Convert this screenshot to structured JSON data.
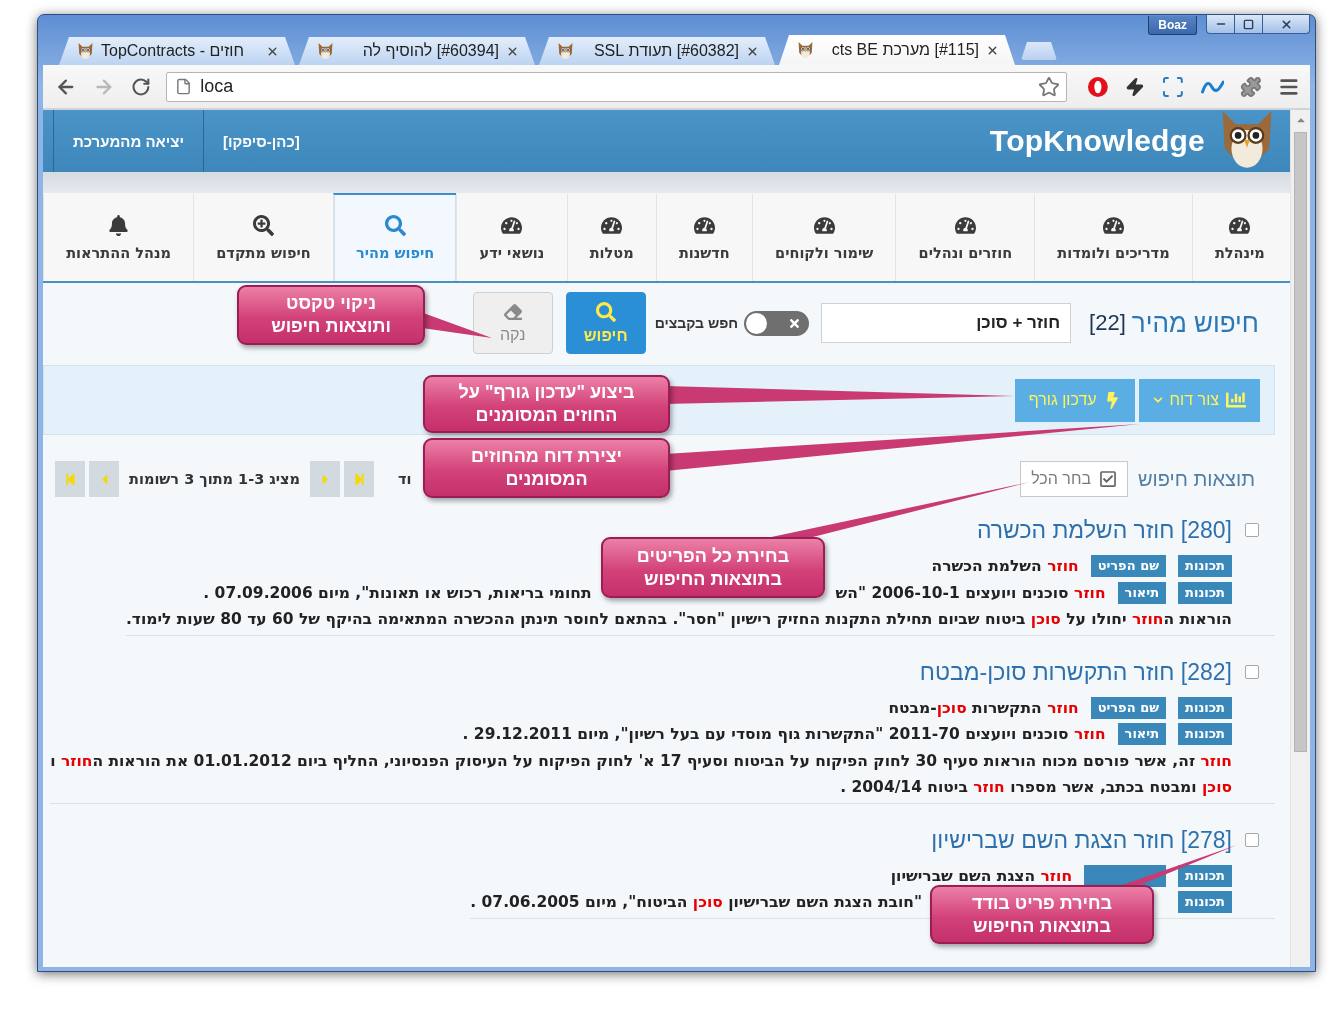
{
  "browser": {
    "profile": "Boaz",
    "tabs": [
      {
        "title": "[#115] מערכת cts BE",
        "selected": true
      },
      {
        "title": "[#60382] תעודת SSL",
        "selected": false
      },
      {
        "title": "[#60394] להוסיף לה",
        "selected": false
      },
      {
        "title": "TopContracts - חוזים",
        "selected": false
      }
    ],
    "address": "loca"
  },
  "header": {
    "brand": "TopKnowledge",
    "links": [
      "[כהן-סיפקו]",
      "יציאה מהמערכת"
    ]
  },
  "nav": [
    {
      "label": "מינהלת",
      "kind": "dashboard",
      "selected": false
    },
    {
      "label": "מדריכים ולומדות",
      "kind": "dashboard",
      "selected": false
    },
    {
      "label": "חוזרים ונהלים",
      "kind": "dashboard",
      "selected": false
    },
    {
      "label": "שימור ולקוחים",
      "kind": "dashboard",
      "selected": false
    },
    {
      "label": "חדשנות",
      "kind": "dashboard",
      "selected": false
    },
    {
      "label": "מטלות",
      "kind": "dashboard",
      "selected": false
    },
    {
      "label": "נושאי ידע",
      "kind": "dashboard",
      "selected": false
    },
    {
      "label": "חיפוש מהיר",
      "kind": "search",
      "selected": true
    },
    {
      "label": "חיפוש מתקדם",
      "kind": "advanced",
      "selected": false
    },
    {
      "label": "מנהל ההתראות",
      "kind": "alerts",
      "selected": false
    }
  ],
  "search": {
    "title": "חיפוש מהיר",
    "count": "[22]",
    "value": "חוזר + סוכן",
    "files_toggle": {
      "label": "חפש בקבצים",
      "on": false
    },
    "buttons": [
      {
        "label": "חיפוש",
        "kind": "search"
      },
      {
        "label": "נקה",
        "kind": "clear"
      }
    ]
  },
  "toolbar": [
    {
      "label": "צור דוח",
      "kind": "report"
    },
    {
      "label": "עדכון גורף",
      "kind": "bulk_update"
    }
  ],
  "results_header": {
    "title": "תוצאות חיפוש",
    "select_all": "בחר הכל",
    "pager_status": "מציג 1-3 מתוך 3 רשומות",
    "partial_text": "וד"
  },
  "results": [
    {
      "title": "[280] חוזר השלמת הכשרה",
      "checked": false,
      "rows": [
        {
          "tags": [
            "תכונות",
            "שם הפריט"
          ],
          "segments": [
            {
              "kind": "text",
              "text": "חוזר",
              "highlight": true
            },
            {
              "kind": "text",
              "text": " השלמת הכשרה",
              "highlight": false
            }
          ]
        },
        {
          "tags": [
            "תכונות",
            "תיאור"
          ],
          "segments": [
            {
              "kind": "text",
              "text": "חוזר",
              "highlight": true
            },
            {
              "kind": "text",
              "text": " סוכנים ויועצים 2006-10-1 \"הש",
              "highlight": false
            },
            {
              "kind": "covered"
            },
            {
              "kind": "text",
              "text": "תחומי בריאות, רכוש או תאונות\", מיום 07.09.2006 .",
              "highlight": false
            }
          ]
        },
        {
          "segments": [
            {
              "kind": "text",
              "text": "הוראות ה",
              "highlight": false
            },
            {
              "kind": "text",
              "text": "חוזר",
              "highlight": true
            },
            {
              "kind": "text",
              "text": " יחולו על ",
              "highlight": false
            },
            {
              "kind": "text",
              "text": "סוכן",
              "highlight": true
            },
            {
              "kind": "text",
              "text": " ביטוח שביום תחילת התקנות החזיק רישיון \"חסר\". בהתאם לחוסר תינתן ההכשרה המתאימה בהיקף של 60 עד 80 שעות לימוד.",
              "highlight": false
            }
          ]
        }
      ]
    },
    {
      "title": "[282] חוזר התקשרות סוכן-מבטח",
      "checked": false,
      "rows": [
        {
          "tags": [
            "תכונות",
            "שם הפריט"
          ],
          "segments": [
            {
              "kind": "text",
              "text": "חוזר",
              "highlight": true
            },
            {
              "kind": "text",
              "text": " התקשרות ",
              "highlight": false
            },
            {
              "kind": "text",
              "text": "סוכן",
              "highlight": true
            },
            {
              "kind": "text",
              "text": "-מבטח",
              "highlight": false
            }
          ]
        },
        {
          "tags": [
            "תכונות",
            "תיאור"
          ],
          "segments": [
            {
              "kind": "text",
              "text": "חוזר",
              "highlight": true
            },
            {
              "kind": "text",
              "text": " סוכנים ויועצים 2011-70 \"התקשרות גוף מוסדי עם בעל רשיון\", מיום 29.12.2011 .",
              "highlight": false
            }
          ]
        },
        {
          "segments": [
            {
              "kind": "text",
              "text": "חוזר",
              "highlight": true
            },
            {
              "kind": "text",
              "text": " זה, אשר פורסם מכוח הוראות סעיף 30 לחוק הפיקוח על הביטוח וסעיף 17 א' לחוק הפיקוח על העיסוק הפנסיוני, החליף ביום 01.01.2012 את הוראות ה",
              "highlight": false
            },
            {
              "kind": "text",
              "text": "חוזר",
              "highlight": true
            },
            {
              "kind": "text",
              "text": " ו",
              "highlight": false
            }
          ]
        },
        {
          "segments": [
            {
              "kind": "text",
              "text": "סוכן",
              "highlight": true
            },
            {
              "kind": "text",
              "text": " ומבטח בכתב, אשר מספרו ",
              "highlight": false
            },
            {
              "kind": "text",
              "text": "חוזר",
              "highlight": true
            },
            {
              "kind": "text",
              "text": " ביטוח 2004/14 .",
              "highlight": false
            }
          ]
        }
      ]
    },
    {
      "title": "[278] חוזר הצגת השם שברישיון",
      "checked": false,
      "rows": [
        {
          "tags": [
            "תכונות"
          ],
          "covered_tag": true,
          "segments": [
            {
              "kind": "text",
              "text": "חוזר",
              "highlight": true
            },
            {
              "kind": "text",
              "text": " הצגת השם שברישיון",
              "highlight": false
            }
          ]
        },
        {
          "tags": [
            "תכונות"
          ],
          "segments": [
            {
              "kind": "covered"
            },
            {
              "kind": "text",
              "text": "\"חובת הצגת השם שברישיון ",
              "highlight": false
            },
            {
              "kind": "text",
              "text": "סוכן",
              "highlight": true
            },
            {
              "kind": "text",
              "text": " הביטוח\", מיום 07.06.2005 .",
              "highlight": false
            }
          ]
        }
      ]
    }
  ],
  "callouts": [
    {
      "lines": [
        "ניקוי טקסט",
        "ותוצאות חיפוש"
      ]
    },
    {
      "lines": [
        "ביצוע \"עדכון גורף\" על",
        "החוזים המסומנים"
      ]
    },
    {
      "lines": [
        "יצירת דוח מהחוזים",
        "המסומנים"
      ]
    },
    {
      "lines": [
        "בחירת כל הפריטים",
        "בתוצאות החיפוש"
      ]
    },
    {
      "lines": [
        "בחירת פריט בודד",
        "בתוצאות החיפוש"
      ]
    }
  ]
}
